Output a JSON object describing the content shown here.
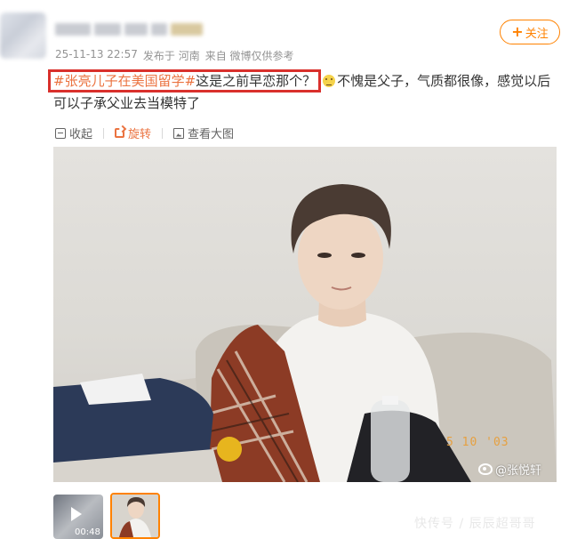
{
  "post": {
    "meta": {
      "time": "25-11-13 22:57",
      "source": "发布于 河南",
      "from": "来自 微博仅供参考"
    },
    "follow_label": "关注",
    "text": {
      "topic": "#张亮儿子在美国留学#",
      "boxed_rest": "这是之前早恋那个？",
      "after": "不愧是父子，气质都很像，感觉以后可以子承父业去当模特了"
    },
    "toolbar": {
      "collapse": "收起",
      "rotate": "旋转",
      "view_large": "查看大图"
    },
    "photo": {
      "date_stamp": "5 10 '03",
      "watermark": "@张悦轩"
    },
    "thumbnails": {
      "video_duration": "00:48"
    },
    "corner_watermark": "快传号 / 辰辰超哥哥"
  },
  "colors": {
    "accent": "#ff8200",
    "topic": "#eb7340",
    "highlight_box": "#d9302c",
    "meta": "#939393"
  }
}
